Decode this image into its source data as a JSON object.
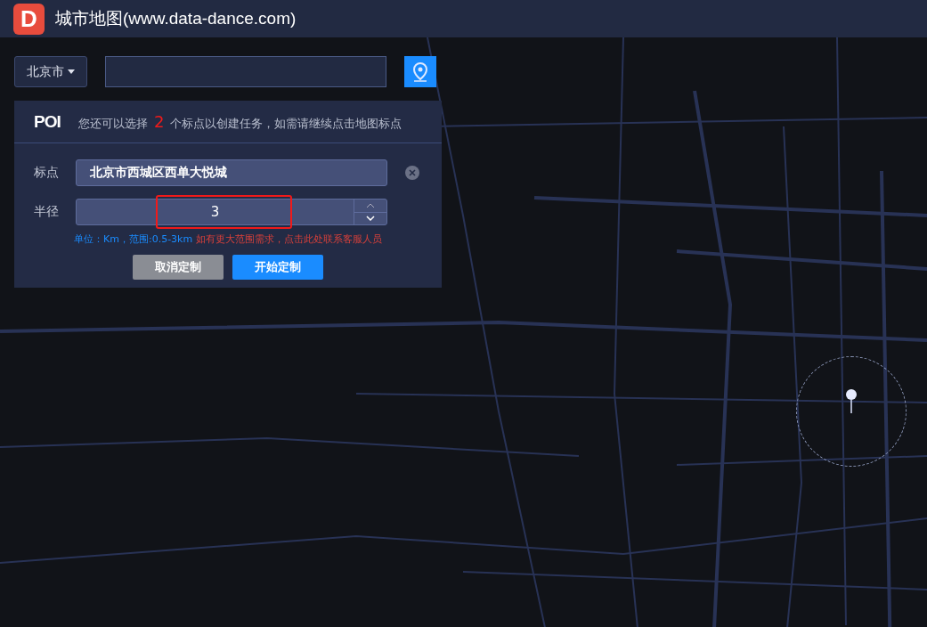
{
  "header": {
    "logo": "D",
    "title": "城市地图(www.data-dance.com)"
  },
  "search": {
    "city": "北京市"
  },
  "poi_panel": {
    "title": "POI",
    "notice": "您还可以选择 **2** 个标点以创建任务，如需请继续点击地图标点",
    "fields": [
      {
        "kind": "text",
        "label": "标点",
        "value": "北京市西城区西单大悦城",
        "clearable": true
      },
      {
        "kind": "number",
        "label": "半径",
        "value": "3",
        "highlighted": true
      }
    ],
    "hint": "单位：Km，范围:0.5-3km",
    "hint_link": "如有更大范围需求，点击此处联系客服人员",
    "buttons": [
      {
        "kind": "secondary",
        "label": "取消定制"
      },
      {
        "kind": "primary",
        "label": "开始定制"
      }
    ]
  }
}
